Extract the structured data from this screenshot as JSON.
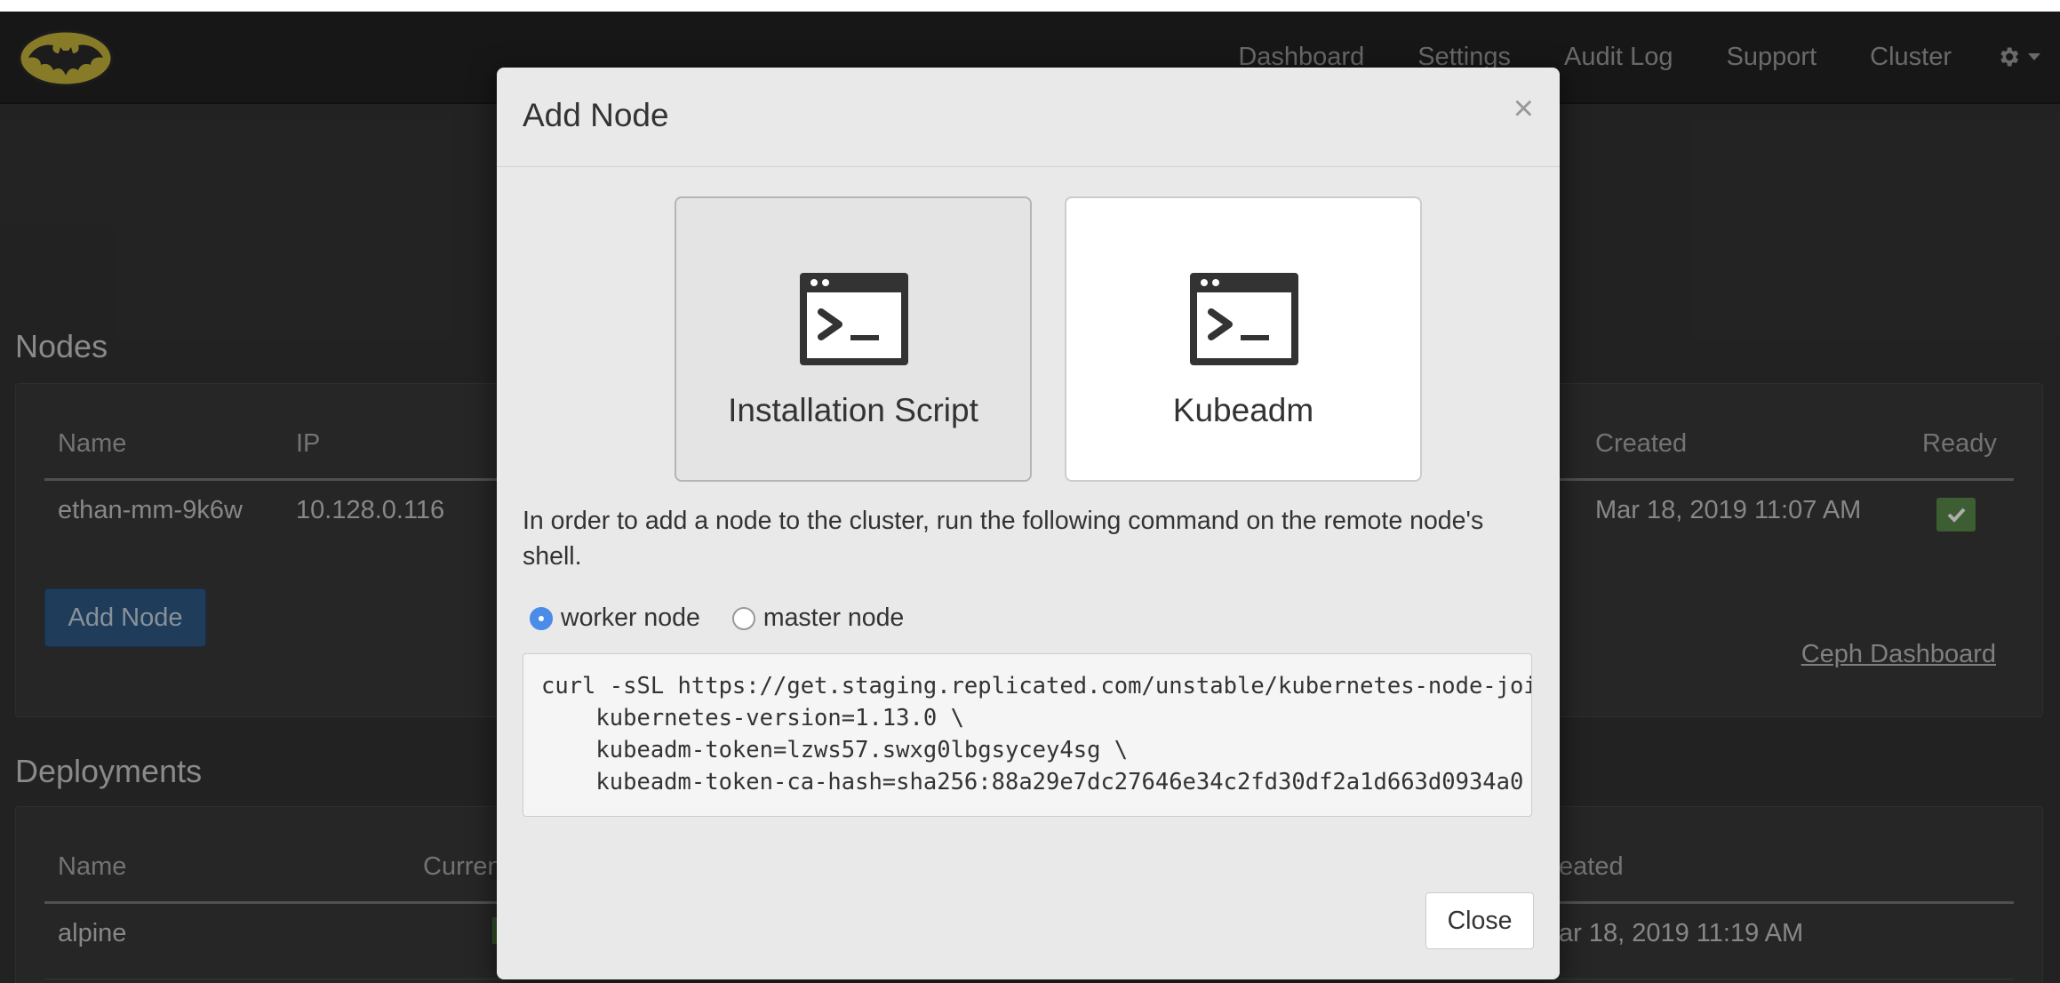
{
  "navbar": {
    "links": [
      "Dashboard",
      "Settings",
      "Audit Log",
      "Support",
      "Cluster"
    ]
  },
  "nodes": {
    "title": "Nodes",
    "headers": {
      "name": "Name",
      "ip": "IP",
      "created": "Created",
      "ready": "Ready"
    },
    "rows": [
      {
        "name": "ethan-mm-9k6w",
        "ip": "10.128.0.116",
        "created": "Mar 18, 2019 11:07 AM",
        "ready": true
      }
    ],
    "add_node_label": "Add Node",
    "ceph_link": "Ceph Dashboard"
  },
  "deployments": {
    "title": "Deployments",
    "headers": {
      "name": "Name",
      "current_partial": "Curren",
      "created_partial": "eated"
    },
    "rows": [
      {
        "name": "alpine",
        "created_partial": "ar 18, 2019 11:19 AM"
      }
    ]
  },
  "modal": {
    "title": "Add Node",
    "close_x": "×",
    "cards": [
      {
        "label": "Installation Script",
        "selected": true,
        "icon": "terminal-icon"
      },
      {
        "label": "Kubeadm",
        "selected": false,
        "icon": "terminal-icon"
      }
    ],
    "instructions": "In order to add a node to the cluster, run the following command on the remote node's shell.",
    "radios": [
      {
        "label": "worker node",
        "checked": true
      },
      {
        "label": "master node",
        "checked": false
      }
    ],
    "command_lines": [
      "curl -sSL https://get.staging.replicated.com/unstable/kubernetes-node-join",
      "    kubernetes-version=1.13.0 \\",
      "    kubeadm-token=lzws57.swxg0lbgsycey4sg \\",
      "    kubeadm-token-ca-hash=sha256:88a29e7dc27646e34c2fd30df2a1d663d0934a0"
    ],
    "close_button": "Close"
  },
  "colors": {
    "navbar_bg": "#222222",
    "page_bg": "#333333",
    "modal_bg": "#e9e9e9",
    "primary_button": "#2f5a85",
    "ready_badge": "#5a8a4a",
    "radio_checked": "#4a8ce8",
    "logo_yellow": "#c8b63c"
  }
}
